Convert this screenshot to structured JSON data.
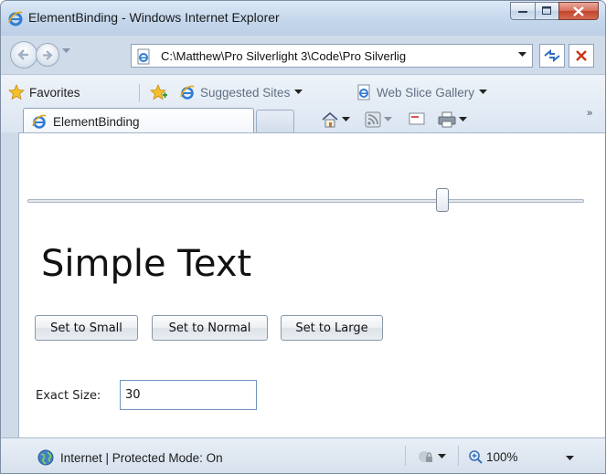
{
  "window": {
    "title": "ElementBinding - Windows Internet Explorer"
  },
  "navigation": {
    "address": "C:\\Matthew\\Pro Silverlight 3\\Code\\Pro Silverlig"
  },
  "favorites_bar": {
    "favorites_label": "Favorites",
    "suggested_sites_label": "Suggested Sites",
    "web_slice_gallery_label": "Web Slice Gallery"
  },
  "tab": {
    "label": "ElementBinding"
  },
  "page": {
    "slider_value": 30,
    "sample_text": "Simple Text",
    "buttons": {
      "small": "Set to Small",
      "normal": "Set to Normal",
      "large": "Set to Large"
    },
    "exact_size_label": "Exact Size:",
    "exact_size_value": "30"
  },
  "status_bar": {
    "zone_text": "Internet | Protected Mode: On",
    "zoom": "100%"
  },
  "colors": {
    "frame": "#cfdbe9",
    "close_button": "#c1442c",
    "textbox_border": "#6f94bf"
  }
}
